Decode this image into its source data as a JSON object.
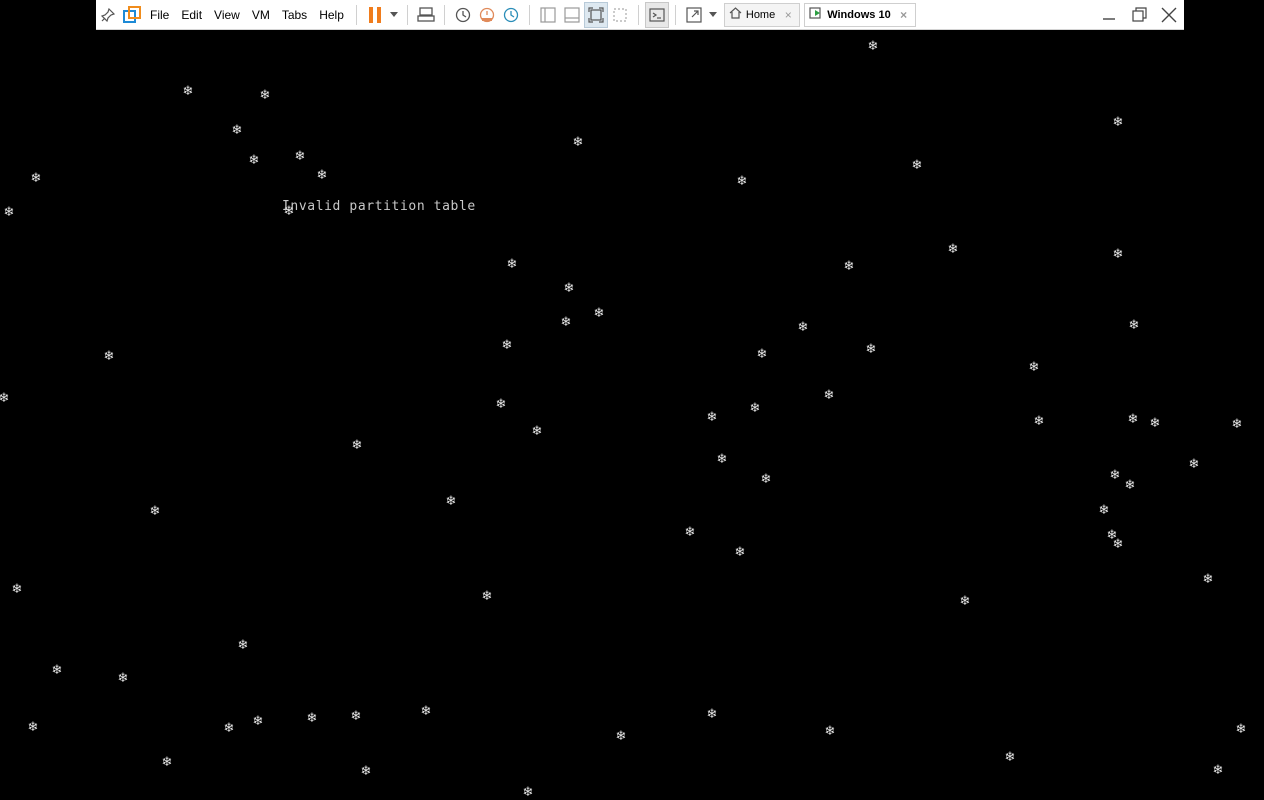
{
  "toolbar": {
    "menu": {
      "file": "File",
      "edit": "Edit",
      "view": "View",
      "vm": "VM",
      "tabs": "Tabs",
      "help": "Help"
    },
    "tabs": [
      {
        "label": "Home",
        "icon": "home-icon"
      },
      {
        "label": "Windows 10",
        "icon": "vm-icon"
      }
    ],
    "pause_color": "#f07c1c"
  },
  "console": {
    "message": "Invalid partition table",
    "background": "#000000",
    "flake_symbol": "❄"
  }
}
